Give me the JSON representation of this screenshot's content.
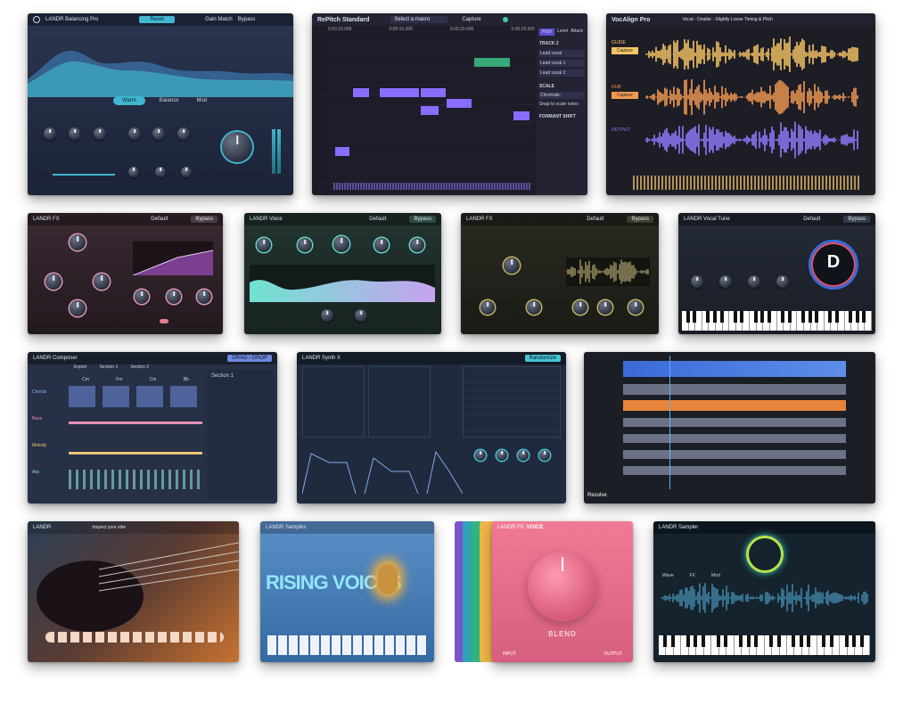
{
  "tiles": {
    "balancing": {
      "title": "LANDR Balancing Pro",
      "button_main": "Reset",
      "menu1": "Gain Match",
      "menu2": "Bypass",
      "tabs": [
        "Warm",
        "Balance",
        "Mod"
      ]
    },
    "repitch": {
      "title": "RePitch Standard",
      "preset": "Select a macro",
      "capture_label": "Capture",
      "time1": "0:00:10.000",
      "time2": "0:00:15.000",
      "time3": "0:00:20.000",
      "time4": "0:00:25.000",
      "tabs": [
        "Pitch",
        "Level",
        "Attack"
      ],
      "panel_labels": [
        "TRACK 2",
        "Lead vocal",
        "Lead vocal 1",
        "Lead vocal 2",
        "SCALE",
        "Chromatic",
        "Snap to scale notes",
        "FORMANT SHIFT"
      ]
    },
    "vocalign": {
      "title": "VocAlign Pro",
      "subtitle": "Vocal - Double - Slightly Loose Timing & Pitch",
      "guide_label": "GUIDE",
      "guide_btn": "Capture",
      "dub_label": "DUB",
      "dub_btn": "Capture",
      "output_label": "OUTPUT"
    },
    "fx_compressor": {
      "title": "LANDR FX",
      "preset": "Default",
      "bypass": "Bypass"
    },
    "fx_voice": {
      "title": "LANDR Voice",
      "preset": "Default",
      "bypass": "Bypass"
    },
    "fx_amp": {
      "title": "LANDR FX",
      "preset": "Default",
      "bypass": "Bypass"
    },
    "vocal_tuner": {
      "title": "LANDR Vocal Tune",
      "preset": "Default",
      "bypass": "Bypass",
      "note": "D"
    },
    "composer": {
      "title": "LANDR Composer",
      "tabs": [
        "Export",
        "Section 1",
        "Section 2"
      ],
      "badge": "DRAG / DROP",
      "side_title": "Section 1",
      "rows": [
        "Chords",
        "Bass",
        "Melody",
        "Arp"
      ],
      "chords": [
        "Cm",
        "Fm",
        "Cm",
        "Bb"
      ]
    },
    "synth": {
      "title": "LANDR Synth X",
      "preset_btn": "Randomize"
    },
    "daw": {
      "brand": "Resolve"
    },
    "guitar": {
      "title": "LANDR",
      "prompt": "Inspect your vibe"
    },
    "rising": {
      "title": "LANDR Samples",
      "headline": "RISING VOICES"
    },
    "fx_voice_big": {
      "title": "LANDR FX",
      "title_accent": "VOICE",
      "blend_label": "BLEND",
      "input_label": "INPUT",
      "output_label": "OUTPUT"
    },
    "sampler": {
      "title": "LANDR Sampler",
      "tabs": [
        "Wave",
        "FX",
        "Mod"
      ]
    }
  },
  "colors": {
    "accent_teal": "#43c6d8",
    "accent_purple": "#8a6cff",
    "wave_yellow": "#f5c464",
    "wave_orange": "#f29a52",
    "wave_violet": "#8f7cff",
    "pink": "#e8778f"
  }
}
